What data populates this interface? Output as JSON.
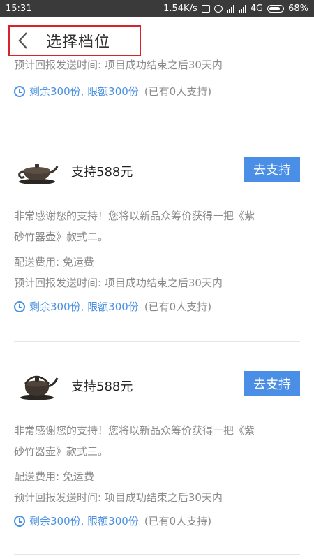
{
  "status_bar": {
    "time": "15:31",
    "speed": "1.54K/s",
    "network": "4G",
    "battery": "68%"
  },
  "header": {
    "title": "选择档位"
  },
  "top_partial": {
    "delivery_time": "预计回报发送时间: 项目成功结束之后30天内",
    "stock_blue": "剩余300份, 限额300份",
    "stock_gray": "(已有0人支持)"
  },
  "tiers": [
    {
      "title": "支持588元",
      "button_label": "去支持",
      "desc_line1": "非常感谢您的支持！您将以新品众筹价获得一把《紫",
      "desc_line2": "砂竹器壶》款式二。",
      "shipping": "配送费用: 免运费",
      "delivery_time": "预计回报发送时间: 项目成功结束之后30天内",
      "stock_blue": "剩余300份, 限额300份",
      "stock_gray": "(已有0人支持)",
      "icon": "teapot-icon"
    },
    {
      "title": "支持588元",
      "button_label": "去支持",
      "desc_line1": "非常感谢您的支持！您将以新品众筹价获得一把《紫",
      "desc_line2": "砂竹器壶》款式三。",
      "shipping": "配送费用: 免运费",
      "delivery_time": "预计回报发送时间: 项目成功结束之后30天内",
      "stock_blue": "剩余300份, 限额300份",
      "stock_gray": "(已有0人支持)",
      "icon": "teapot-icon"
    }
  ],
  "colors": {
    "accent": "#4a8ee6",
    "highlight_border": "#d9232a",
    "status_bar": "#3a3a3a"
  }
}
